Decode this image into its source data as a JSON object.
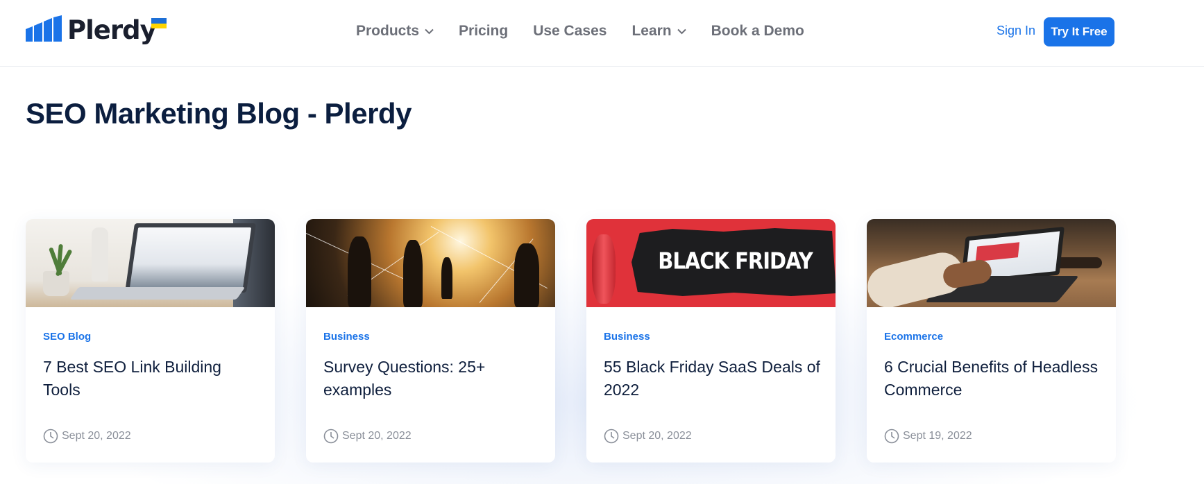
{
  "brand": {
    "name": "Plerdy"
  },
  "nav": {
    "items": [
      {
        "label": "Products",
        "has_dropdown": true
      },
      {
        "label": "Pricing",
        "has_dropdown": false
      },
      {
        "label": "Use Cases",
        "has_dropdown": false
      },
      {
        "label": "Learn",
        "has_dropdown": true
      },
      {
        "label": "Book a Demo",
        "has_dropdown": false
      }
    ]
  },
  "auth": {
    "sign_in": "Sign In",
    "try_free": "Try It Free"
  },
  "page": {
    "title": "SEO Marketing Blog - Plerdy"
  },
  "cards": [
    {
      "category": "SEO Blog",
      "title": "7 Best SEO Link Building Tools",
      "date": "Sept 20, 2022"
    },
    {
      "category": "Business",
      "title": "Survey Questions: 25+ examples",
      "date": "Sept 20, 2022"
    },
    {
      "category": "Business",
      "title": "55 Black Friday SaaS Deals of 2022",
      "date": "Sept 20, 2022",
      "image_text": "BLACK FRIDAY"
    },
    {
      "category": "Ecommerce",
      "title": "6 Crucial Benefits of Headless Commerce",
      "date": "Sept 19, 2022"
    }
  ],
  "colors": {
    "accent": "#1a73e8",
    "title": "#0b1e3f",
    "nav_text": "#6c6f78",
    "muted": "#8a8f99"
  }
}
